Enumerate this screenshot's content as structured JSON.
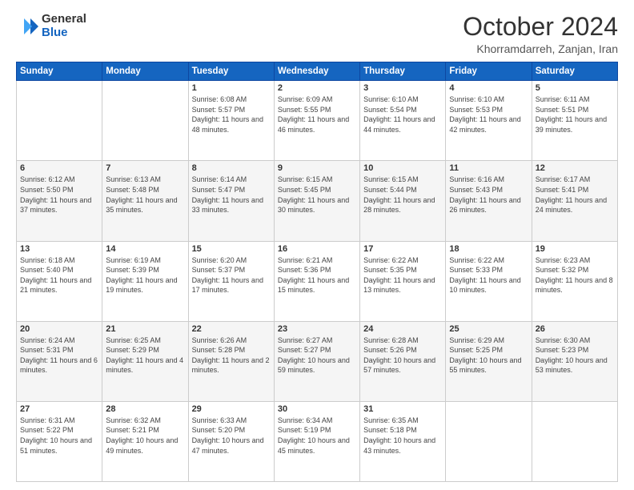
{
  "logo": {
    "general": "General",
    "blue": "Blue"
  },
  "header": {
    "month": "October 2024",
    "location": "Khorramdarreh, Zanjan, Iran"
  },
  "weekdays": [
    "Sunday",
    "Monday",
    "Tuesday",
    "Wednesday",
    "Thursday",
    "Friday",
    "Saturday"
  ],
  "weeks": [
    [
      {
        "day": "",
        "info": ""
      },
      {
        "day": "",
        "info": ""
      },
      {
        "day": "1",
        "info": "Sunrise: 6:08 AM\nSunset: 5:57 PM\nDaylight: 11 hours and 48 minutes."
      },
      {
        "day": "2",
        "info": "Sunrise: 6:09 AM\nSunset: 5:55 PM\nDaylight: 11 hours and 46 minutes."
      },
      {
        "day": "3",
        "info": "Sunrise: 6:10 AM\nSunset: 5:54 PM\nDaylight: 11 hours and 44 minutes."
      },
      {
        "day": "4",
        "info": "Sunrise: 6:10 AM\nSunset: 5:53 PM\nDaylight: 11 hours and 42 minutes."
      },
      {
        "day": "5",
        "info": "Sunrise: 6:11 AM\nSunset: 5:51 PM\nDaylight: 11 hours and 39 minutes."
      }
    ],
    [
      {
        "day": "6",
        "info": "Sunrise: 6:12 AM\nSunset: 5:50 PM\nDaylight: 11 hours and 37 minutes."
      },
      {
        "day": "7",
        "info": "Sunrise: 6:13 AM\nSunset: 5:48 PM\nDaylight: 11 hours and 35 minutes."
      },
      {
        "day": "8",
        "info": "Sunrise: 6:14 AM\nSunset: 5:47 PM\nDaylight: 11 hours and 33 minutes."
      },
      {
        "day": "9",
        "info": "Sunrise: 6:15 AM\nSunset: 5:45 PM\nDaylight: 11 hours and 30 minutes."
      },
      {
        "day": "10",
        "info": "Sunrise: 6:15 AM\nSunset: 5:44 PM\nDaylight: 11 hours and 28 minutes."
      },
      {
        "day": "11",
        "info": "Sunrise: 6:16 AM\nSunset: 5:43 PM\nDaylight: 11 hours and 26 minutes."
      },
      {
        "day": "12",
        "info": "Sunrise: 6:17 AM\nSunset: 5:41 PM\nDaylight: 11 hours and 24 minutes."
      }
    ],
    [
      {
        "day": "13",
        "info": "Sunrise: 6:18 AM\nSunset: 5:40 PM\nDaylight: 11 hours and 21 minutes."
      },
      {
        "day": "14",
        "info": "Sunrise: 6:19 AM\nSunset: 5:39 PM\nDaylight: 11 hours and 19 minutes."
      },
      {
        "day": "15",
        "info": "Sunrise: 6:20 AM\nSunset: 5:37 PM\nDaylight: 11 hours and 17 minutes."
      },
      {
        "day": "16",
        "info": "Sunrise: 6:21 AM\nSunset: 5:36 PM\nDaylight: 11 hours and 15 minutes."
      },
      {
        "day": "17",
        "info": "Sunrise: 6:22 AM\nSunset: 5:35 PM\nDaylight: 11 hours and 13 minutes."
      },
      {
        "day": "18",
        "info": "Sunrise: 6:22 AM\nSunset: 5:33 PM\nDaylight: 11 hours and 10 minutes."
      },
      {
        "day": "19",
        "info": "Sunrise: 6:23 AM\nSunset: 5:32 PM\nDaylight: 11 hours and 8 minutes."
      }
    ],
    [
      {
        "day": "20",
        "info": "Sunrise: 6:24 AM\nSunset: 5:31 PM\nDaylight: 11 hours and 6 minutes."
      },
      {
        "day": "21",
        "info": "Sunrise: 6:25 AM\nSunset: 5:29 PM\nDaylight: 11 hours and 4 minutes."
      },
      {
        "day": "22",
        "info": "Sunrise: 6:26 AM\nSunset: 5:28 PM\nDaylight: 11 hours and 2 minutes."
      },
      {
        "day": "23",
        "info": "Sunrise: 6:27 AM\nSunset: 5:27 PM\nDaylight: 10 hours and 59 minutes."
      },
      {
        "day": "24",
        "info": "Sunrise: 6:28 AM\nSunset: 5:26 PM\nDaylight: 10 hours and 57 minutes."
      },
      {
        "day": "25",
        "info": "Sunrise: 6:29 AM\nSunset: 5:25 PM\nDaylight: 10 hours and 55 minutes."
      },
      {
        "day": "26",
        "info": "Sunrise: 6:30 AM\nSunset: 5:23 PM\nDaylight: 10 hours and 53 minutes."
      }
    ],
    [
      {
        "day": "27",
        "info": "Sunrise: 6:31 AM\nSunset: 5:22 PM\nDaylight: 10 hours and 51 minutes."
      },
      {
        "day": "28",
        "info": "Sunrise: 6:32 AM\nSunset: 5:21 PM\nDaylight: 10 hours and 49 minutes."
      },
      {
        "day": "29",
        "info": "Sunrise: 6:33 AM\nSunset: 5:20 PM\nDaylight: 10 hours and 47 minutes."
      },
      {
        "day": "30",
        "info": "Sunrise: 6:34 AM\nSunset: 5:19 PM\nDaylight: 10 hours and 45 minutes."
      },
      {
        "day": "31",
        "info": "Sunrise: 6:35 AM\nSunset: 5:18 PM\nDaylight: 10 hours and 43 minutes."
      },
      {
        "day": "",
        "info": ""
      },
      {
        "day": "",
        "info": ""
      }
    ]
  ]
}
